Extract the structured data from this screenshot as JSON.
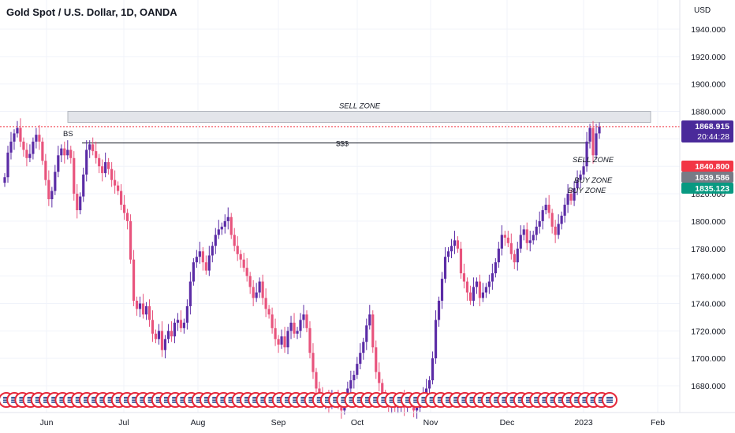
{
  "title": "Gold Spot / U.S. Dollar, 1D, OANDA",
  "price_axis": {
    "currency": "USD",
    "ticks": [
      "1940.000",
      "1920.000",
      "1900.000",
      "1880.000",
      "1860.000",
      "1840.000",
      "1820.000",
      "1800.000",
      "1780.000",
      "1760.000",
      "1740.000",
      "1720.000",
      "1700.000",
      "1680.000"
    ]
  },
  "time_axis": {
    "ticks": [
      "Jun",
      "Jul",
      "Aug",
      "Sep",
      "Oct",
      "Nov",
      "Dec",
      "2023",
      "Feb"
    ]
  },
  "badges": {
    "last_price": "1868.915",
    "countdown": "20:44:28",
    "level_1": "1840.800",
    "level_2": "1839.586",
    "level_3": "1835.123"
  },
  "annotations": {
    "sell_zone_top": "SELL ZONE",
    "sss": "$$$",
    "bs": "BS",
    "sell_zone_small": "SELL ZONE",
    "buy_zone_1": "BUY ZONE",
    "buy_zone_2": "BUY ZONE"
  },
  "colors": {
    "up": "#5b2ca6",
    "down": "#e8547d",
    "last_price_bg": "#4a2a9a",
    "level_1_bg": "#f23645",
    "level_2_bg": "#787b86",
    "level_3_bg": "#089981",
    "zone_fill": "#e3e5ea",
    "event_icon": "#e5283a"
  },
  "chart_data": {
    "type": "candlestick",
    "title": "Gold Spot / U.S. Dollar, 1D, OANDA",
    "ylim": [
      1664,
      1950
    ],
    "last_price": 1868.915,
    "sell_zone": [
      1872,
      1880
    ],
    "sss_level": 1857,
    "closes": [
      1832,
      1850,
      1858,
      1864,
      1868,
      1858,
      1852,
      1846,
      1849,
      1858,
      1863,
      1858,
      1844,
      1830,
      1816,
      1822,
      1836,
      1848,
      1853,
      1848,
      1852,
      1846,
      1820,
      1808,
      1818,
      1834,
      1852,
      1856,
      1851,
      1846,
      1840,
      1835,
      1843,
      1838,
      1830,
      1826,
      1822,
      1812,
      1806,
      1800,
      1772,
      1742,
      1736,
      1740,
      1732,
      1738,
      1728,
      1718,
      1714,
      1720,
      1706,
      1714,
      1720,
      1716,
      1726,
      1728,
      1722,
      1726,
      1738,
      1756,
      1770,
      1774,
      1778,
      1770,
      1764,
      1775,
      1782,
      1790,
      1794,
      1796,
      1800,
      1803,
      1790,
      1782,
      1776,
      1772,
      1766,
      1760,
      1752,
      1744,
      1748,
      1756,
      1744,
      1736,
      1732,
      1722,
      1714,
      1710,
      1716,
      1708,
      1720,
      1726,
      1718,
      1720,
      1728,
      1732,
      1722,
      1704,
      1690,
      1678,
      1672,
      1668,
      1672,
      1666,
      1670,
      1672,
      1668,
      1662,
      1672,
      1678,
      1684,
      1688,
      1696,
      1704,
      1712,
      1724,
      1732,
      1708,
      1690,
      1682,
      1672,
      1668,
      1666,
      1670,
      1664,
      1666,
      1672,
      1664,
      1668,
      1670,
      1662,
      1664,
      1668,
      1674,
      1678,
      1684,
      1700,
      1728,
      1742,
      1758,
      1774,
      1778,
      1782,
      1786,
      1780,
      1762,
      1756,
      1748,
      1742,
      1752,
      1756,
      1744,
      1748,
      1752,
      1756,
      1762,
      1770,
      1780,
      1790,
      1788,
      1784,
      1776,
      1770,
      1780,
      1790,
      1794,
      1784,
      1786,
      1790,
      1796,
      1800,
      1808,
      1812,
      1806,
      1796,
      1790,
      1798,
      1804,
      1812,
      1820,
      1815,
      1824,
      1830,
      1834,
      1840,
      1858,
      1868,
      1848,
      1864,
      1869
    ]
  }
}
